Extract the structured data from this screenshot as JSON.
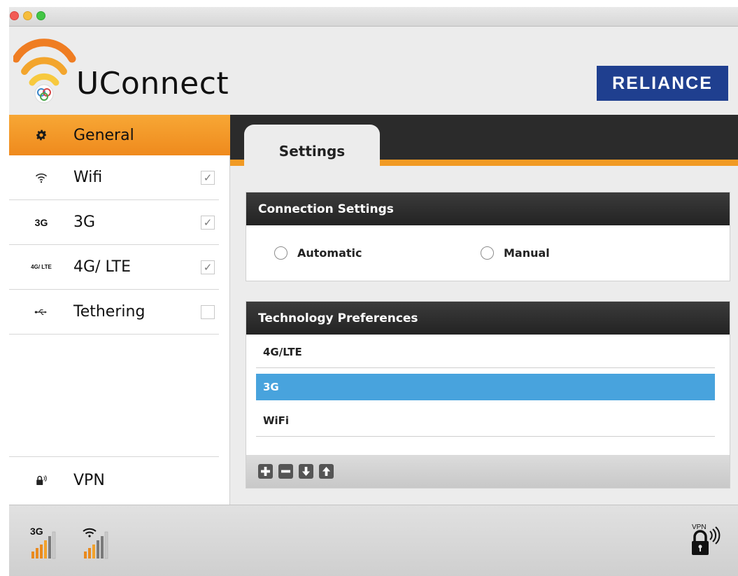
{
  "app": {
    "name": "UConnect",
    "brand": "RELIANCE"
  },
  "sidebar": {
    "items": [
      {
        "icon": "gear-icon",
        "label": "General",
        "active": true
      },
      {
        "icon": "wifi-icon",
        "label": "Wifi",
        "checked": true
      },
      {
        "icon_text": "3G",
        "label": "3G",
        "checked": true
      },
      {
        "icon_text": "4G/ LTE",
        "label": "4G/ LTE",
        "checked": true
      },
      {
        "icon": "usb-icon",
        "label": "Tethering",
        "checked": false
      }
    ],
    "vpn": {
      "icon": "lock-signal-icon",
      "label": "VPN"
    }
  },
  "main": {
    "tab": "Settings",
    "connection_settings": {
      "title": "Connection Settings",
      "options": [
        "Automatic",
        "Manual"
      ]
    },
    "technology_preferences": {
      "title": "Technology Preferences",
      "items": [
        "4G/LTE",
        "3G",
        "WiFi"
      ],
      "selected": "3G"
    }
  },
  "statusbar": {
    "network_label": "3G",
    "vpn_label": "VPN"
  },
  "colors": {
    "accent_orange": "#f19a24",
    "selection_blue": "#48a3dd",
    "brand_blue": "#1f3f8f",
    "dark_header": "#2b2b2b"
  }
}
